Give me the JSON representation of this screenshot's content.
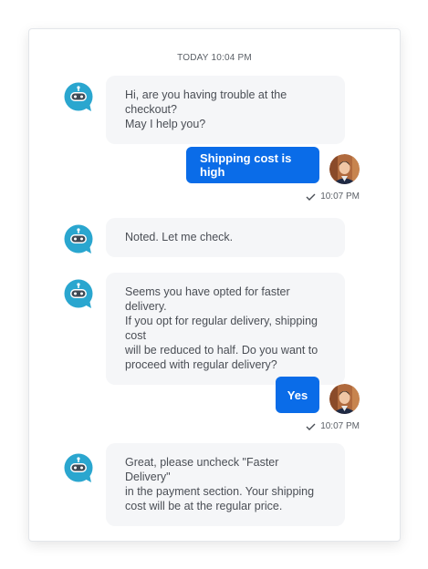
{
  "chat": {
    "timestamp": "TODAY 10:04 PM",
    "messages": [
      {
        "sender": "bot",
        "text": "Hi, are you having trouble at the checkout?\nMay I help you?"
      },
      {
        "sender": "user",
        "text": "Shipping cost is high",
        "time": "10:07 PM",
        "status_icon": "check-icon"
      },
      {
        "sender": "bot",
        "text": "Noted. Let me check."
      },
      {
        "sender": "bot",
        "text": "Seems you have opted for faster delivery.\nIf you opt for regular delivery, shipping cost\nwill be reduced to half. Do you want to\nproceed with regular delivery?"
      },
      {
        "sender": "user",
        "text": "Yes",
        "time": "10:07 PM",
        "status_icon": "check-icon"
      },
      {
        "sender": "bot",
        "text": "Great, please uncheck \"Faster Delivery\"\nin the payment section. Your shipping\ncost will be at the regular price."
      }
    ]
  },
  "colors": {
    "accent": "#0a6ce8",
    "bot_icon": "#2aa6cf",
    "bot_bubble": "#f5f6f8"
  }
}
